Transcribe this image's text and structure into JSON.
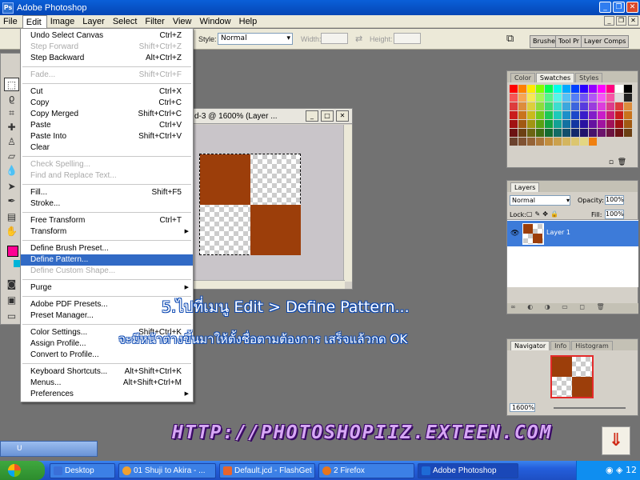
{
  "window": {
    "title": "Adobe Photoshop"
  },
  "menubar": [
    "File",
    "Edit",
    "Image",
    "Layer",
    "Select",
    "Filter",
    "View",
    "Window",
    "Help"
  ],
  "options": {
    "style_label": "Style:",
    "style_value": "Normal",
    "width_label": "Width:",
    "height_label": "Height:",
    "dock_tabs": [
      "Brushes",
      "Tool Pr",
      "Layer Comps"
    ]
  },
  "edit_menu": [
    {
      "label": "Undo Select Canvas",
      "shortcut": "Ctrl+Z"
    },
    {
      "label": "Step Forward",
      "shortcut": "Shift+Ctrl+Z",
      "disabled": true
    },
    {
      "label": "Step Backward",
      "shortcut": "Alt+Ctrl+Z"
    },
    {
      "sep": true
    },
    {
      "label": "Fade...",
      "shortcut": "Shift+Ctrl+F",
      "disabled": true
    },
    {
      "sep": true
    },
    {
      "label": "Cut",
      "shortcut": "Ctrl+X"
    },
    {
      "label": "Copy",
      "shortcut": "Ctrl+C"
    },
    {
      "label": "Copy Merged",
      "shortcut": "Shift+Ctrl+C"
    },
    {
      "label": "Paste",
      "shortcut": "Ctrl+V"
    },
    {
      "label": "Paste Into",
      "shortcut": "Shift+Ctrl+V"
    },
    {
      "label": "Clear",
      "shortcut": ""
    },
    {
      "sep": true
    },
    {
      "label": "Check Spelling...",
      "shortcut": "",
      "disabled": true
    },
    {
      "label": "Find and Replace Text...",
      "shortcut": "",
      "disabled": true
    },
    {
      "sep": true
    },
    {
      "label": "Fill...",
      "shortcut": "Shift+F5"
    },
    {
      "label": "Stroke...",
      "shortcut": ""
    },
    {
      "sep": true
    },
    {
      "label": "Free Transform",
      "shortcut": "Ctrl+T"
    },
    {
      "label": "Transform",
      "shortcut": "",
      "submenu": true
    },
    {
      "sep": true
    },
    {
      "label": "Define Brush Preset...",
      "shortcut": ""
    },
    {
      "label": "Define Pattern...",
      "shortcut": "",
      "highlighted": true
    },
    {
      "label": "Define Custom Shape...",
      "shortcut": "",
      "disabled": true
    },
    {
      "sep": true
    },
    {
      "label": "Purge",
      "shortcut": "",
      "submenu": true
    },
    {
      "sep": true
    },
    {
      "label": "Adobe PDF Presets...",
      "shortcut": ""
    },
    {
      "label": "Preset Manager...",
      "shortcut": ""
    },
    {
      "sep": true
    },
    {
      "label": "Color Settings...",
      "shortcut": "Shift+Ctrl+K"
    },
    {
      "label": "Assign Profile...",
      "shortcut": ""
    },
    {
      "label": "Convert to Profile...",
      "shortcut": ""
    },
    {
      "sep": true
    },
    {
      "label": "Keyboard Shortcuts...",
      "shortcut": "Alt+Shift+Ctrl+K"
    },
    {
      "label": "Menus...",
      "shortcut": "Alt+Shift+Ctrl+M"
    },
    {
      "label": "Preferences",
      "shortcut": "",
      "submenu": true
    }
  ],
  "document": {
    "title": "d-3 @ 1600% (Layer ..."
  },
  "colors": {
    "pattern_brown": "#9c3e0a",
    "foreground": "#ff0093",
    "highlight": "#316ac5"
  },
  "swatches_panel": {
    "tabs": [
      "Color",
      "Swatches",
      "Styles"
    ]
  },
  "layers_panel": {
    "tab": "Layers",
    "blend_mode": "Normal",
    "opacity_label": "Opacity:",
    "opacity_value": "100%",
    "lock_label": "Lock:",
    "fill_label": "Fill:",
    "fill_value": "100%",
    "layer_name": "Layer 1"
  },
  "navigator_panel": {
    "tabs": [
      "Navigator",
      "Info",
      "Histogram"
    ],
    "zoom": "1600%"
  },
  "overlay": {
    "step": "5.ไปที่เมนู Edit > Define Pattern...",
    "desc": "จะมีหน้าต่างขึ้นมาให้ตั้งชื่อตามต้องการ เสร็จแล้วกด OK",
    "url": "HTTP://PHOTOSHOPIIZ.EXTEEN.COM"
  },
  "minidoc_label": "U",
  "taskbar": {
    "items": [
      "Desktop",
      "01 Shuji to Akira - ...",
      "Default.jcd - FlashGet",
      "2 Firefox",
      "Adobe Photoshop"
    ],
    "clock": "12"
  }
}
